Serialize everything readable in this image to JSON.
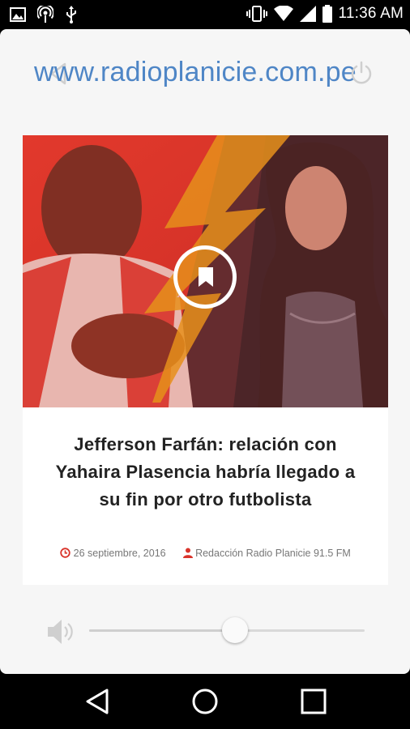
{
  "status_bar": {
    "time": "11:36 AM",
    "icons": [
      "image-notification-icon",
      "podcast-icon",
      "usb-icon",
      "vibrate-icon",
      "wifi-icon",
      "signal-icon",
      "battery-icon"
    ]
  },
  "header": {
    "site_url": "www.radioplanicie.com.pe",
    "left_icon": "back-icon",
    "right_icon": "power-icon"
  },
  "news": {
    "title": "Jefferson Farfán: relación con Yahaira Plasencia habría llegado a su fin por otro futbolista",
    "date": "26 septiembre, 2016",
    "author": "Redacción Radio Planicie 91.5 FM",
    "date_icon": "clock-icon",
    "author_icon": "user-icon",
    "play_icon": "bookmark-icon",
    "image_icon": "news-photo"
  },
  "volume": {
    "icon": "speaker-icon",
    "level": 0.53
  },
  "colors": {
    "accent": "#4f86c6",
    "meta_icon": "#d9342b",
    "title_text": "#222222"
  },
  "nav_bar": {
    "icons": [
      "back-triangle-icon",
      "home-circle-icon",
      "recents-square-icon"
    ]
  }
}
